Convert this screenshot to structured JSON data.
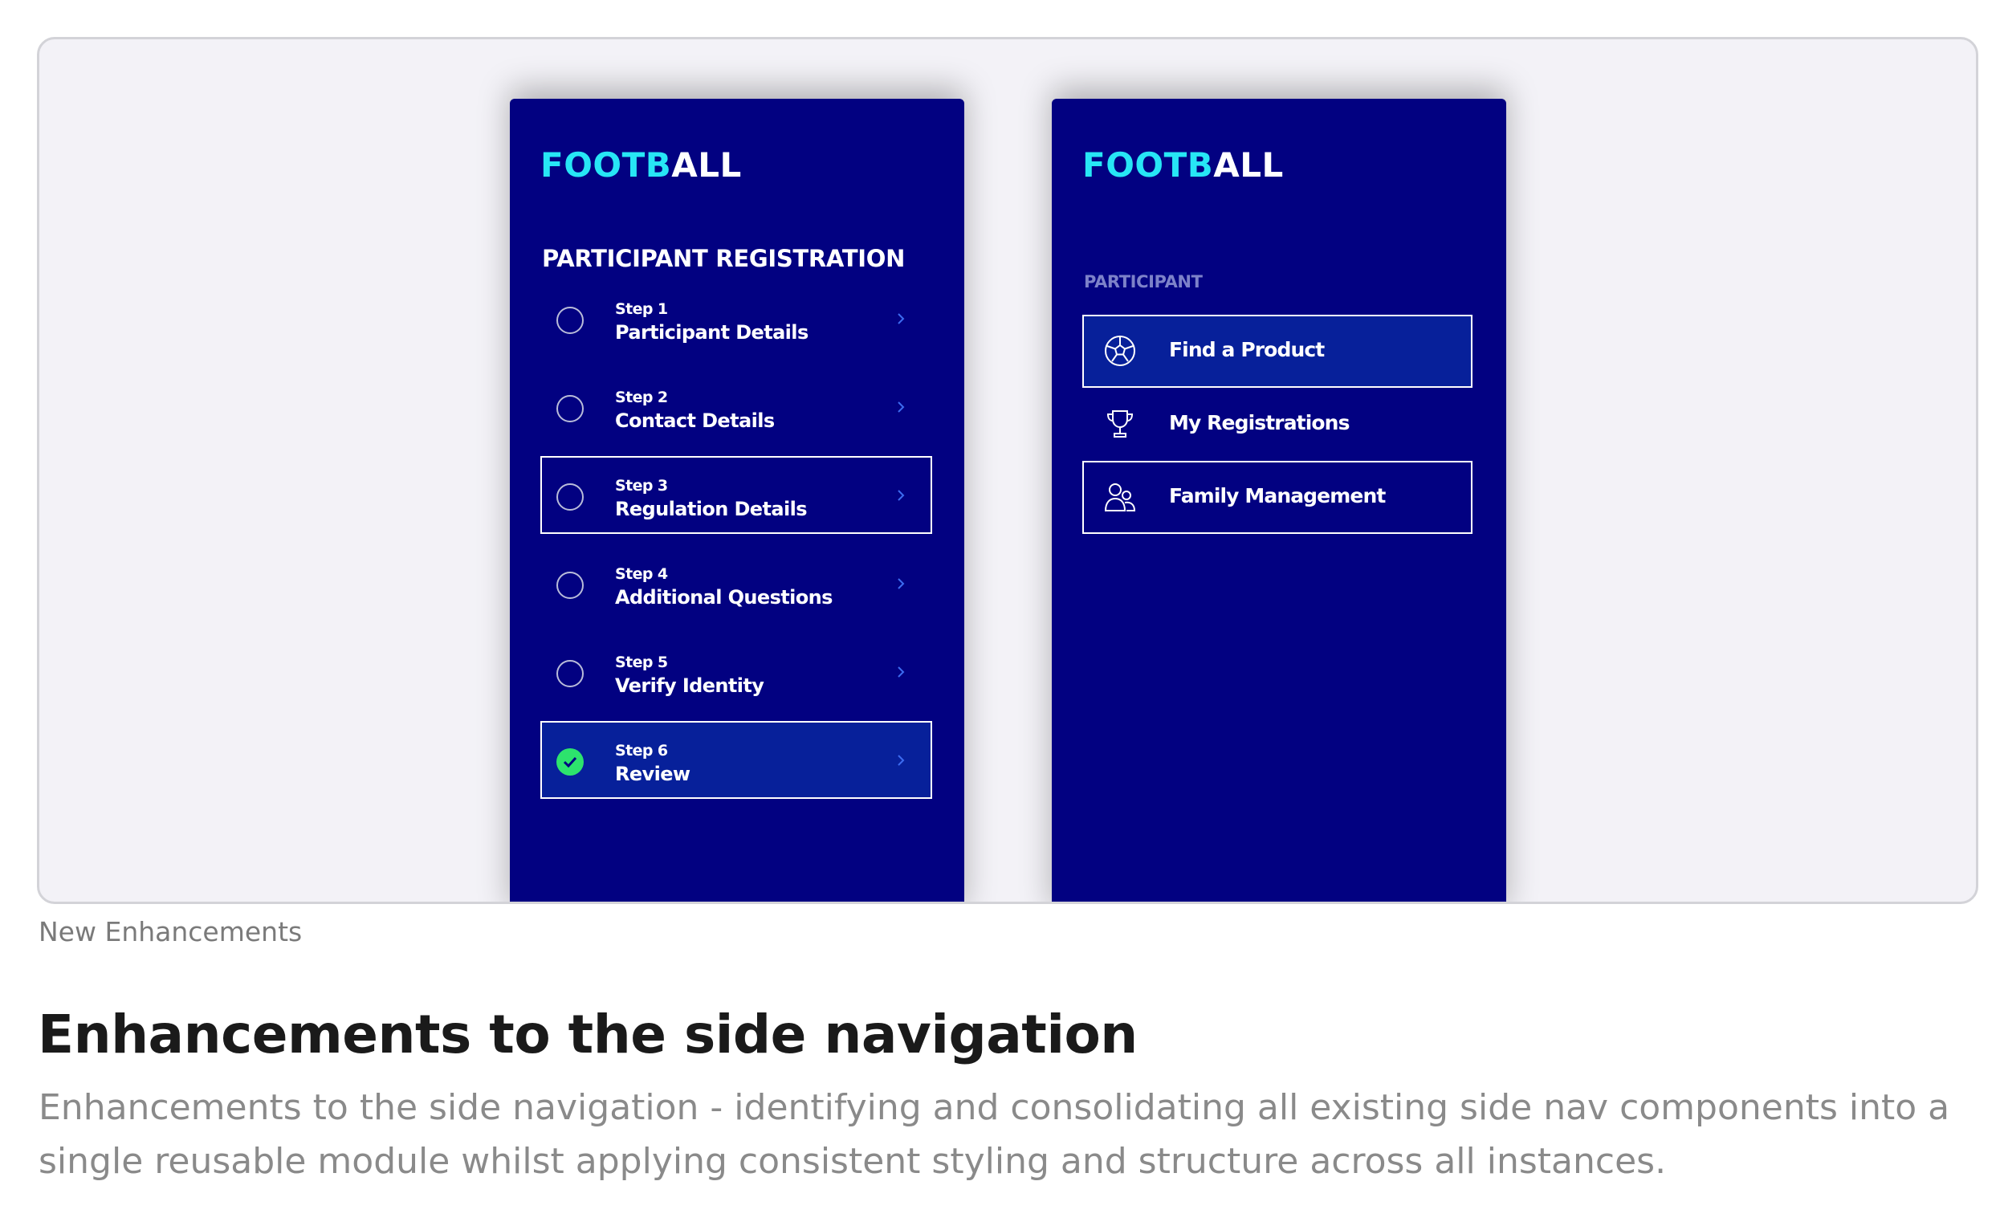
{
  "showcase": {
    "left_panel": {
      "logo": {
        "part_a": "FOOTB",
        "part_b": "ALL"
      },
      "title": "PARTICIPANT REGISTRATION",
      "steps": [
        {
          "num": "Step 1",
          "label": "Participant Details",
          "state": "default"
        },
        {
          "num": "Step 2",
          "label": "Contact Details",
          "state": "default"
        },
        {
          "num": "Step 3",
          "label": "Regulation Details",
          "state": "selected"
        },
        {
          "num": "Step 4",
          "label": "Additional Questions",
          "state": "default"
        },
        {
          "num": "Step 5",
          "label": "Verify Identity",
          "state": "default"
        },
        {
          "num": "Step 6",
          "label": "Review",
          "state": "complete"
        }
      ]
    },
    "right_panel": {
      "logo": {
        "part_a": "FOOTB",
        "part_b": "ALL"
      },
      "section_label": "PARTICIPANT",
      "items": [
        {
          "label": "Find a Product",
          "icon": "football-icon",
          "state": "active"
        },
        {
          "label": "My Registrations",
          "icon": "trophy-icon",
          "state": "default"
        },
        {
          "label": "Family Management",
          "icon": "users-icon",
          "state": "selected"
        }
      ]
    }
  },
  "caption": "New Enhancements",
  "heading": "Enhancements to the side navigation",
  "description": "Enhancements to the side navigation - identifying and consolidating all existing side nav components into a single reusable module whilst applying consistent styling and structure across all instances.",
  "colors": {
    "panel_bg": "#020181",
    "logo_accent": "#27e6f5",
    "active_bg": "#07209a",
    "check_green": "#2de36d",
    "section_label": "#7d82c9"
  }
}
